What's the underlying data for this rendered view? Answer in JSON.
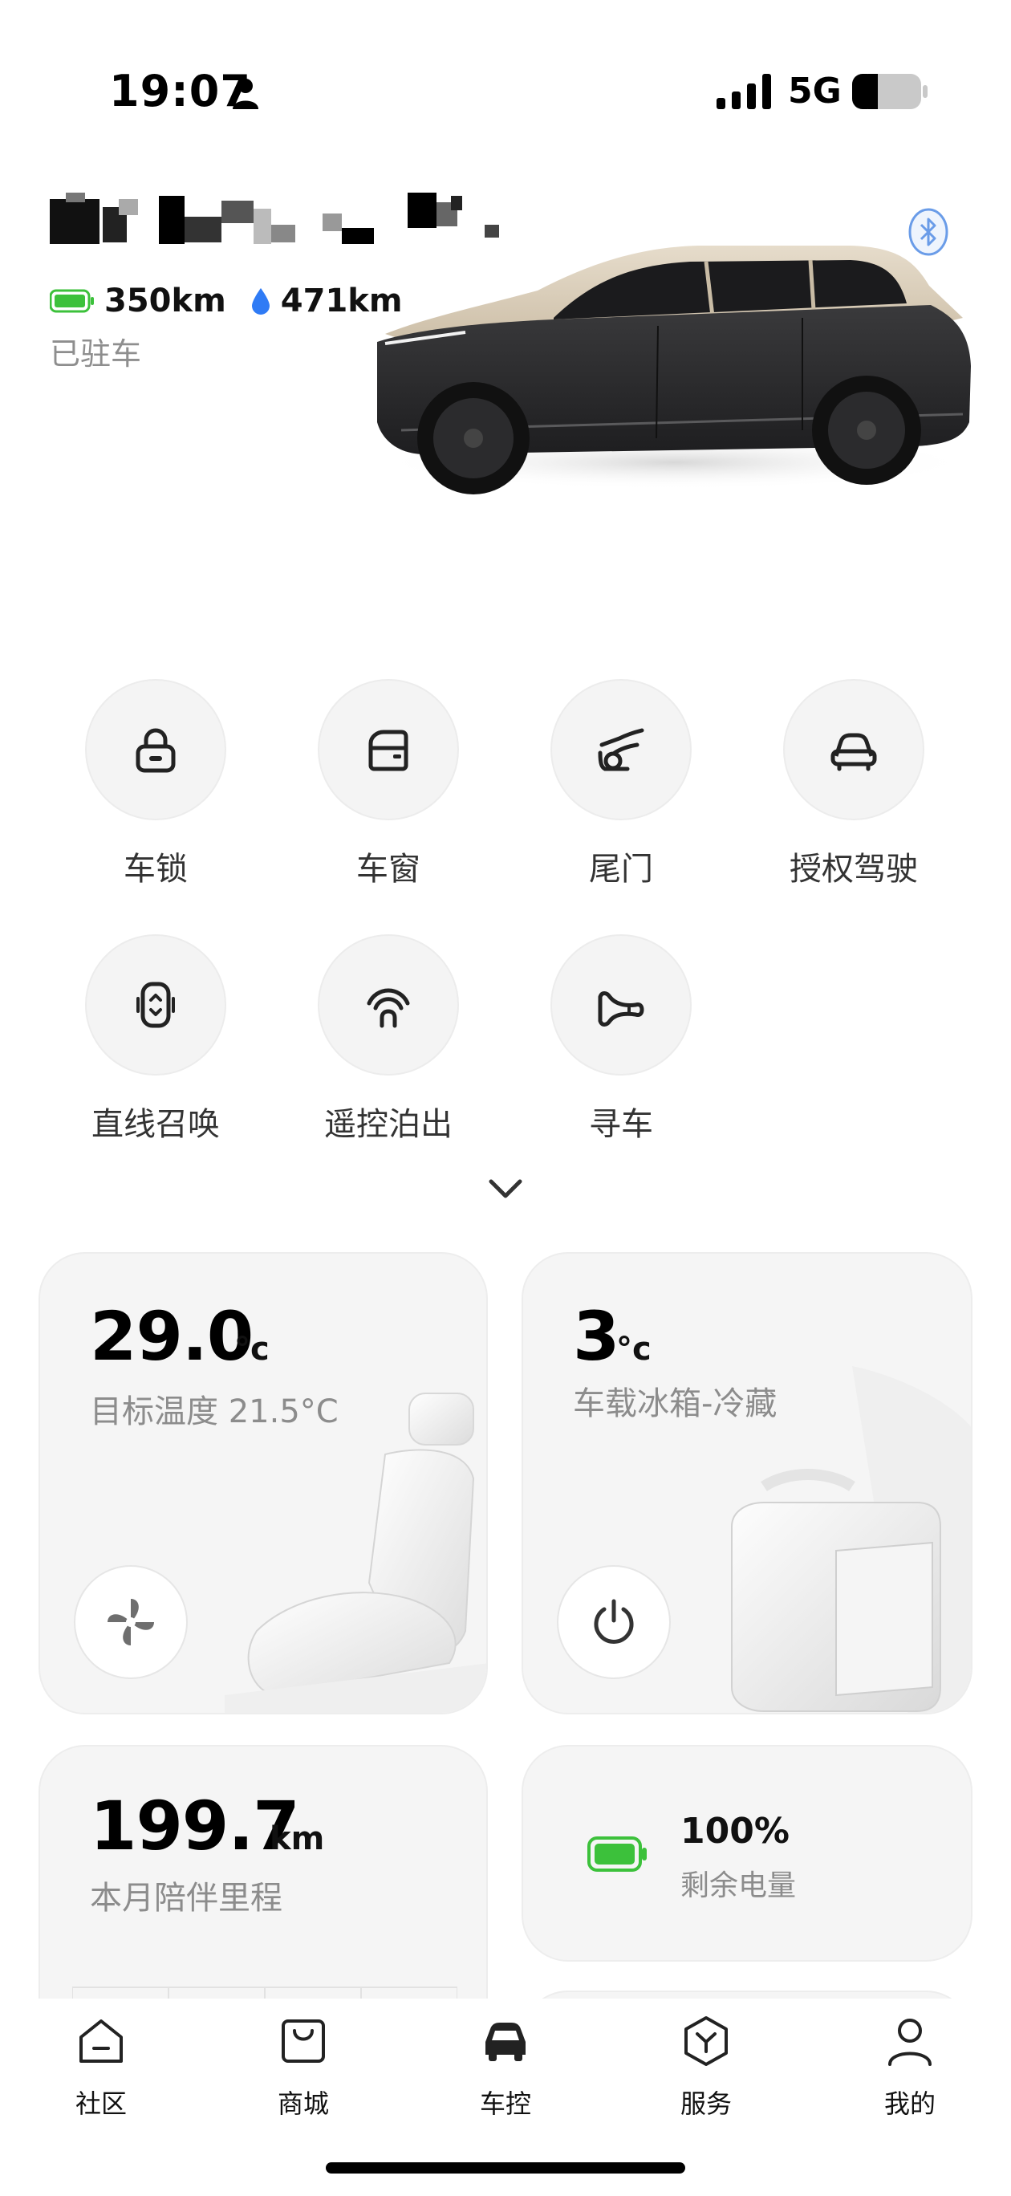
{
  "status_bar": {
    "time": "19:07",
    "network": "5G",
    "icons": [
      "person-icon",
      "signal-icon",
      "battery-icon"
    ]
  },
  "vehicle": {
    "electric_range": "350km",
    "fuel_range": "471km",
    "status": "已驻车",
    "colors": {
      "battery_green": "#3cc13b",
      "fuel_blue": "#2f7bf5",
      "bluetooth_blue": "#6a9ce8"
    }
  },
  "controls": [
    {
      "label": "车锁",
      "icon": "lock-icon"
    },
    {
      "label": "车窗",
      "icon": "window-icon"
    },
    {
      "label": "尾门",
      "icon": "tailgate-icon"
    },
    {
      "label": "授权驾驶",
      "icon": "authorized-drive-icon"
    },
    {
      "label": "直线召唤",
      "icon": "summon-icon"
    },
    {
      "label": "遥控泊出",
      "icon": "remote-park-icon"
    },
    {
      "label": "寻车",
      "icon": "horn-icon"
    }
  ],
  "climate_card": {
    "temp": "29.0",
    "unit": "°c",
    "target": "目标温度 21.5°C"
  },
  "fridge_card": {
    "temp": "3",
    "unit": "°c",
    "label": "车载冰箱-冷藏"
  },
  "mileage_card": {
    "value": "199.7",
    "unit": "km",
    "label": "本月陪伴里程"
  },
  "battery_card": {
    "percent": "100%",
    "label": "剩余电量"
  },
  "bottom_nav": [
    {
      "label": "社区",
      "icon": "community-icon"
    },
    {
      "label": "商城",
      "icon": "shop-icon"
    },
    {
      "label": "车控",
      "icon": "car-control-icon",
      "active": true
    },
    {
      "label": "服务",
      "icon": "service-icon"
    },
    {
      "label": "我的",
      "icon": "profile-icon"
    }
  ]
}
